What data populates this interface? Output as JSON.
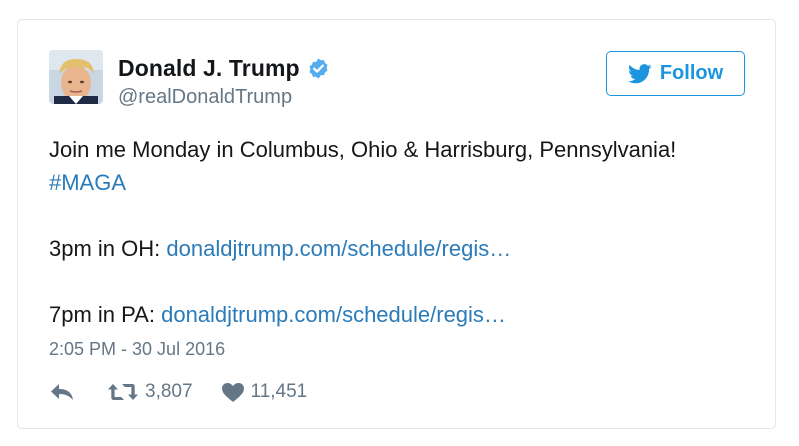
{
  "user": {
    "name": "Donald J. Trump",
    "handle": "@realDonaldTrump",
    "verified": true,
    "avatar_icon": "profile-photo"
  },
  "follow_button": {
    "label": "Follow",
    "icon": "twitter-bird-icon"
  },
  "tweet": {
    "line1": "Join me Monday in Columbus, Ohio & Harrisburg, Pennsylvania!",
    "hashtag": "#MAGA",
    "oh_prefix": "3pm in OH: ",
    "oh_link": "donaldjtrump.com/schedule/regis…",
    "pa_prefix": "7pm in PA: ",
    "pa_link": "donaldjtrump.com/schedule/regis…"
  },
  "timestamp": "2:05 PM - 30 Jul 2016",
  "actions": {
    "reply_icon": "reply-icon",
    "retweet_icon": "retweet-icon",
    "retweet_count": "3,807",
    "like_icon": "heart-icon",
    "like_count": "11,451"
  },
  "colors": {
    "link": "#2b7bb9",
    "follow": "#1b95e0",
    "muted": "#657786",
    "border": "#e1e8ed"
  }
}
